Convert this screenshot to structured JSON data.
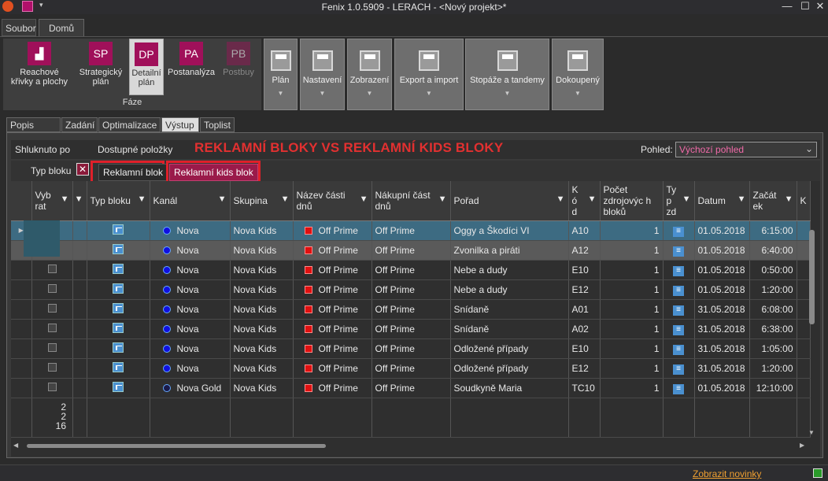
{
  "window": {
    "title": "Fenix 1.0.5909 - LERACH - <Nový projekt>*",
    "minimize": "—",
    "restore": "☐",
    "close": "✕"
  },
  "menu": {
    "soubor": "Soubor",
    "domu": "Domů"
  },
  "ribbon": {
    "faze_label": "Fáze",
    "buttons": [
      {
        "icon": "chart-icon",
        "glyph": "📈",
        "label1": "Reachové",
        "label2": "křivky a plochy"
      },
      {
        "icon": "SP",
        "label1": "Strategický",
        "label2": "plán"
      },
      {
        "icon": "DP",
        "label1": "Detailní",
        "label2": "plán"
      },
      {
        "icon": "PA",
        "label1": "Postanalýza",
        "label2": ""
      },
      {
        "icon": "PB",
        "label1": "Postbuy",
        "label2": ""
      }
    ],
    "groups": [
      "Plán",
      "Nastavení",
      "Zobrazení",
      "Export a import",
      "Stopáže a tandemy",
      "Dokoupený"
    ]
  },
  "subtabs": [
    "Popis plánu",
    "Zadání",
    "Optimalizace",
    "Výstup",
    "Toplist"
  ],
  "toolbar": {
    "grouped_by": "Shluknuto po",
    "available": "Dostupné položky",
    "headline": "REKLAMNÍ BLOKY VS REKLAMNÍ KIDS BLOKY",
    "view_label": "Pohled:",
    "view_value": "Výchozí pohled"
  },
  "group_row": {
    "field": "Typ bloku",
    "chip1": "Reklamní blok",
    "chip2": "Reklamní kids blok"
  },
  "grid": {
    "headers": {
      "vybrat": "Vyb rat",
      "typ_bloku": "Typ bloku",
      "kanal": "Kanál",
      "skupina": "Skupina",
      "nazev": "Název části dnů",
      "nakupni": "Nákupní část dnů",
      "porad": "Pořad",
      "kod": "K ó d",
      "pocet": "Počet zdrojovýc h bloků",
      "typzd": "Ty p zd",
      "datum": "Datum",
      "zacatek": "Začát ek",
      "extra": "K"
    },
    "rows": [
      {
        "checked": true,
        "kanal": "Nova",
        "skupina": "Nova Kids",
        "nazev": "Off Prime",
        "nakupni": "Off Prime",
        "porad": "Oggy a Škodíci VI",
        "kod": "A10",
        "pocet": "1",
        "datum": "01.05.2018",
        "zacatek": "6:15:00"
      },
      {
        "checked": true,
        "kanal": "Nova",
        "skupina": "Nova Kids",
        "nazev": "Off Prime",
        "nakupni": "Off Prime",
        "porad": "Zvonilka a piráti",
        "kod": "A12",
        "pocet": "1",
        "datum": "01.05.2018",
        "zacatek": "6:40:00"
      },
      {
        "checked": false,
        "kanal": "Nova",
        "skupina": "Nova Kids",
        "nazev": "Off Prime",
        "nakupni": "Off Prime",
        "porad": "Nebe a dudy",
        "kod": "E10",
        "pocet": "1",
        "datum": "01.05.2018",
        "zacatek": "0:50:00"
      },
      {
        "checked": false,
        "kanal": "Nova",
        "skupina": "Nova Kids",
        "nazev": "Off Prime",
        "nakupni": "Off Prime",
        "porad": "Nebe a dudy",
        "kod": "E12",
        "pocet": "1",
        "datum": "01.05.2018",
        "zacatek": "1:20:00"
      },
      {
        "checked": false,
        "kanal": "Nova",
        "skupina": "Nova Kids",
        "nazev": "Off Prime",
        "nakupni": "Off Prime",
        "porad": "Snídaně",
        "kod": "A01",
        "pocet": "1",
        "datum": "31.05.2018",
        "zacatek": "6:08:00"
      },
      {
        "checked": false,
        "kanal": "Nova",
        "skupina": "Nova Kids",
        "nazev": "Off Prime",
        "nakupni": "Off Prime",
        "porad": "Snídaně",
        "kod": "A02",
        "pocet": "1",
        "datum": "31.05.2018",
        "zacatek": "6:38:00"
      },
      {
        "checked": false,
        "kanal": "Nova",
        "skupina": "Nova Kids",
        "nazev": "Off Prime",
        "nakupni": "Off Prime",
        "porad": "Odložené případy",
        "kod": "E10",
        "pocet": "1",
        "datum": "31.05.2018",
        "zacatek": "1:05:00"
      },
      {
        "checked": false,
        "kanal": "Nova",
        "skupina": "Nova Kids",
        "nazev": "Off Prime",
        "nakupni": "Off Prime",
        "porad": "Odložené případy",
        "kod": "E12",
        "pocet": "1",
        "datum": "31.05.2018",
        "zacatek": "1:20:00"
      },
      {
        "checked": false,
        "kanal": "Nova Gold",
        "skupina": "Nova Kids",
        "nazev": "Off Prime",
        "nakupni": "Off Prime",
        "porad": "Soudkyně Maria",
        "kod": "TC10",
        "pocet": "1",
        "datum": "01.05.2018",
        "zacatek": "12:10:00"
      }
    ],
    "totals": [
      "2",
      "2",
      "16"
    ]
  },
  "status": {
    "news": "Zobrazit novinky"
  },
  "colors": {
    "accent": "#a0105a",
    "headline": "#e23030",
    "selected_row": "#3d6b82",
    "news": "#f0a030"
  }
}
